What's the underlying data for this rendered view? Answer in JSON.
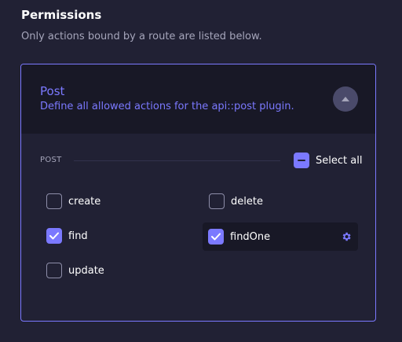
{
  "page": {
    "title": "Permissions",
    "subtitle": "Only actions bound by a route are listed below."
  },
  "panel": {
    "title": "Post",
    "description": "Define all allowed actions for the api::post plugin.",
    "expanded": true
  },
  "section": {
    "label": "POST",
    "select_all_label": "Select all",
    "select_all_state": "indeterminate"
  },
  "permissions": [
    {
      "label": "create",
      "checked": false
    },
    {
      "label": "delete",
      "checked": false
    },
    {
      "label": "find",
      "checked": true
    },
    {
      "label": "findOne",
      "checked": true
    },
    {
      "label": "update",
      "checked": false
    }
  ],
  "colors": {
    "accent": "#7b79ff",
    "background": "#212134",
    "header": "#181826",
    "muted_text": "#a5a5ba",
    "button": "#4a4a6a"
  },
  "icons": {
    "collapse": "chevron-up-icon",
    "settings": "gear-icon",
    "check": "checkmark-icon",
    "indeterminate": "minus-icon"
  }
}
